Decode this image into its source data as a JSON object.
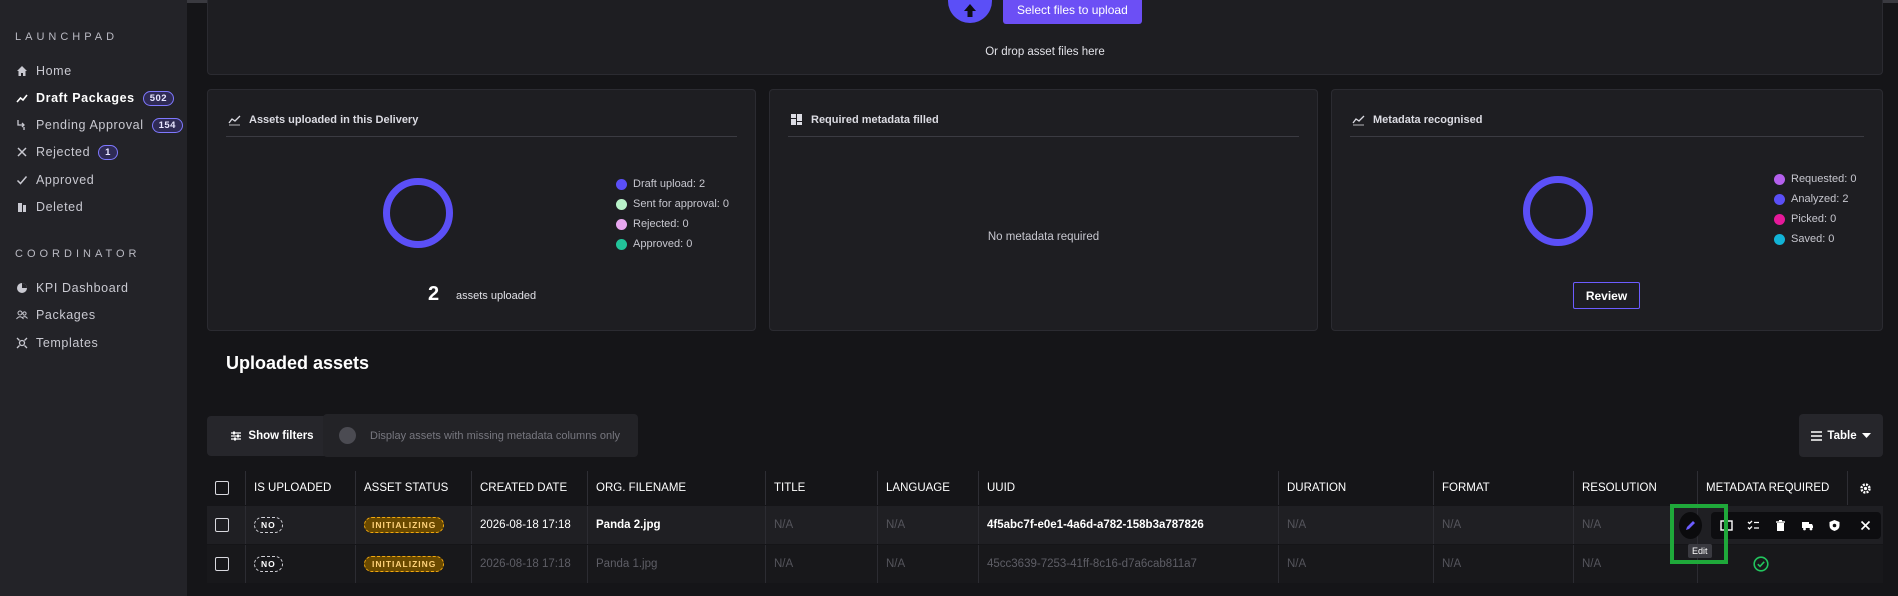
{
  "sidebar": {
    "sections": [
      {
        "title": "LAUNCHPAD",
        "items": [
          {
            "label": "Home",
            "icon": "home-icon"
          },
          {
            "label": "Draft Packages",
            "icon": "trending-icon",
            "badge": "502",
            "active": true
          },
          {
            "label": "Pending Approval",
            "icon": "pending-icon",
            "badge": "154"
          },
          {
            "label": "Rejected",
            "icon": "close-icon",
            "badge": "1"
          },
          {
            "label": "Approved",
            "icon": "check-icon"
          },
          {
            "label": "Deleted",
            "icon": "trash-icon"
          }
        ]
      },
      {
        "title": "COORDINATOR",
        "items": [
          {
            "label": "KPI Dashboard",
            "icon": "chart-pie-icon"
          },
          {
            "label": "Packages",
            "icon": "packages-icon"
          },
          {
            "label": "Templates",
            "icon": "templates-icon"
          }
        ]
      }
    ]
  },
  "upload": {
    "button_label": "Select files to upload",
    "drop_text": "Or drop asset files here"
  },
  "stats": {
    "assets_uploaded": {
      "title": "Assets uploaded in this Delivery",
      "count": "2",
      "count_label": "assets uploaded",
      "legend": [
        {
          "label": "Draft upload: 2",
          "color": "#5b4ff7"
        },
        {
          "label": "Sent for approval: 0",
          "color": "#b8f2c8"
        },
        {
          "label": "Rejected: 0",
          "color": "#e8a6ef"
        },
        {
          "label": "Approved: 0",
          "color": "#22c49a"
        }
      ]
    },
    "required_metadata": {
      "title": "Required metadata filled",
      "empty_text": "No metadata required"
    },
    "metadata_recognised": {
      "title": "Metadata recognised",
      "review_label": "Review",
      "legend": [
        {
          "label": "Requested: 0",
          "color": "#b460ee"
        },
        {
          "label": "Analyzed: 2",
          "color": "#5b4ff7"
        },
        {
          "label": "Picked: 0",
          "color": "#e6199a"
        },
        {
          "label": "Saved: 0",
          "color": "#12b3d6"
        }
      ]
    }
  },
  "uploaded_assets": {
    "title": "Uploaded assets",
    "show_filters_label": "Show filters",
    "missing_toggle_label": "Display assets with missing metadata columns only",
    "view_label": "Table",
    "columns": [
      "IS UPLOADED",
      "ASSET STATUS",
      "CREATED DATE",
      "ORG. FILENAME",
      "TITLE",
      "LANGUAGE",
      "UUID",
      "DURATION",
      "FORMAT",
      "RESOLUTION",
      "METADATA REQUIRED"
    ],
    "rows": [
      {
        "is_uploaded": "NO",
        "status": "INITIALIZING",
        "created": "2026-08-18 17:18",
        "filename": "Panda 2.jpg",
        "title": "N/A",
        "language": "N/A",
        "uuid": "4f5abc7f-e0e1-4a6d-a782-158b3a787826",
        "duration": "N/A",
        "format": "N/A",
        "resolution": "N/A"
      },
      {
        "is_uploaded": "NO",
        "status": "INITIALIZING",
        "created": "2026-08-18 17:18",
        "filename": "Panda 1.jpg",
        "title": "N/A",
        "language": "N/A",
        "uuid": "45cc3639-7253-41ff-8c16-d7a6cab811a7",
        "duration": "N/A",
        "format": "N/A",
        "resolution": "N/A"
      }
    ],
    "tooltip": "Edit"
  }
}
